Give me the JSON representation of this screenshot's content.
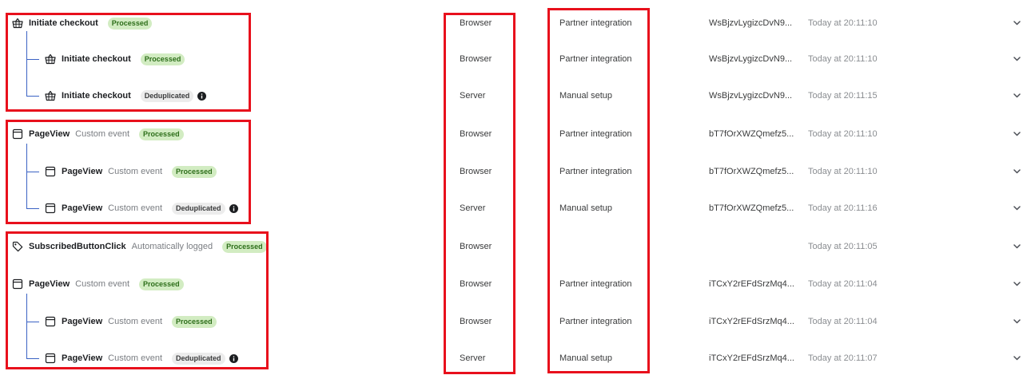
{
  "rows": [
    {
      "icon": "basket-icon",
      "name": "Initiate checkout",
      "type": "",
      "status": "Processed",
      "status_kind": "processed",
      "source": "Browser",
      "method": "Partner integration",
      "event_id": "WsBjzvLygizcDvN9...",
      "time": "Today at 20:11:10",
      "child": false,
      "info": false
    },
    {
      "icon": "basket-icon",
      "name": "Initiate checkout",
      "type": "",
      "status": "Processed",
      "status_kind": "processed",
      "source": "Browser",
      "method": "Partner integration",
      "event_id": "WsBjzvLygizcDvN9...",
      "time": "Today at 20:11:10",
      "child": true,
      "info": false
    },
    {
      "icon": "basket-icon",
      "name": "Initiate checkout",
      "type": "",
      "status": "Deduplicated",
      "status_kind": "dedup",
      "source": "Server",
      "method": "Manual setup",
      "event_id": "WsBjzvLygizcDvN9...",
      "time": "Today at 20:11:15",
      "child": true,
      "info": true
    },
    {
      "icon": "page-icon",
      "name": "PageView",
      "type": "Custom event",
      "status": "Processed",
      "status_kind": "processed",
      "source": "Browser",
      "method": "Partner integration",
      "event_id": "bT7fOrXWZQmefz5...",
      "time": "Today at 20:11:10",
      "child": false,
      "info": false
    },
    {
      "icon": "page-icon",
      "name": "PageView",
      "type": "Custom event",
      "status": "Processed",
      "status_kind": "processed",
      "source": "Browser",
      "method": "Partner integration",
      "event_id": "bT7fOrXWZQmefz5...",
      "time": "Today at 20:11:10",
      "child": true,
      "info": false
    },
    {
      "icon": "page-icon",
      "name": "PageView",
      "type": "Custom event",
      "status": "Deduplicated",
      "status_kind": "dedup",
      "source": "Server",
      "method": "Manual setup",
      "event_id": "bT7fOrXWZQmefz5...",
      "time": "Today at 20:11:16",
      "child": true,
      "info": true
    },
    {
      "icon": "tag-icon",
      "name": "SubscribedButtonClick",
      "type": "Automatically logged",
      "status": "Processed",
      "status_kind": "processed",
      "source": "Browser",
      "method": "",
      "event_id": "",
      "time": "Today at 20:11:05",
      "child": false,
      "info": false
    },
    {
      "icon": "page-icon",
      "name": "PageView",
      "type": "Custom event",
      "status": "Processed",
      "status_kind": "processed",
      "source": "Browser",
      "method": "Partner integration",
      "event_id": "iTCxY2rEFdSrzMq4...",
      "time": "Today at 20:11:04",
      "child": false,
      "info": false
    },
    {
      "icon": "page-icon",
      "name": "PageView",
      "type": "Custom event",
      "status": "Processed",
      "status_kind": "processed",
      "source": "Browser",
      "method": "Partner integration",
      "event_id": "iTCxY2rEFdSrzMq4...",
      "time": "Today at 20:11:04",
      "child": true,
      "info": false
    },
    {
      "icon": "page-icon",
      "name": "PageView",
      "type": "Custom event",
      "status": "Deduplicated",
      "status_kind": "dedup",
      "source": "Server",
      "method": "Manual setup",
      "event_id": "iTCxY2rEFdSrzMq4...",
      "time": "Today at 20:11:07",
      "child": true,
      "info": true
    }
  ],
  "colors": {
    "highlight": "#e8101c",
    "tree_line": "#3b63c4",
    "processed_bg": "#d2ecc2",
    "dedup_bg": "#ececec"
  }
}
